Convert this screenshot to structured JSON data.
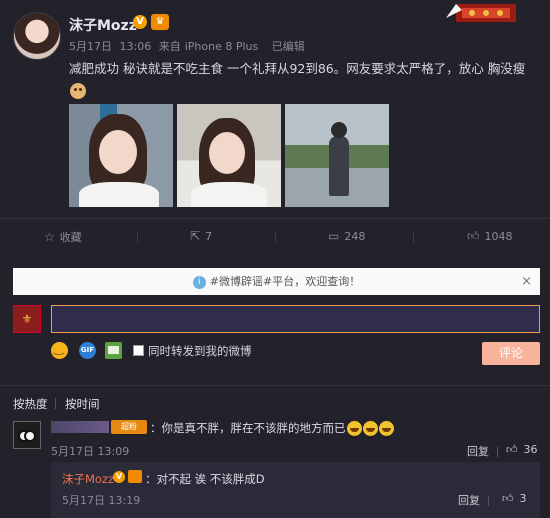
{
  "post": {
    "author": "沫子Mozz",
    "date": "5月17日",
    "time": "13:06",
    "source_prefix": "来自",
    "source": "iPhone 8 Plus",
    "edited": "已编辑",
    "text": "减肥成功 秘诀就是不吃主食 一个礼拜从92到86。网友要求太严格了，放心 胸没瘦",
    "v_badge": "V"
  },
  "actions": {
    "favorite": "收藏",
    "repost_count": "7",
    "comment_count": "248",
    "like_count": "1048"
  },
  "notice": {
    "text": "#微博辟谣#平台，欢迎查询！",
    "close": "×"
  },
  "composer": {
    "repost_label": "同时转发到我的微博",
    "submit": "评论",
    "gif_label": "GIF"
  },
  "sort_tabs": {
    "hot": "按热度",
    "time": "按时间"
  },
  "comment": {
    "badge": "超粉",
    "text": "：你是真不胖，胖在不该胖的地方而已",
    "time": "5月17日 13:09",
    "reply_label": "回复",
    "likes": "36"
  },
  "reply": {
    "author": "沫子Mozz",
    "v_badge": "V",
    "text": "：对不起 诶 不该胖成D",
    "time": "5月17日 13:19",
    "reply_label": "回复",
    "likes": "3"
  },
  "colors": {
    "background": "#23222b",
    "accent_orange": "#f39a4e",
    "reply_name": "#eb7350",
    "submit_button": "#f7b49a"
  },
  "icons": [
    "star-icon",
    "repost-icon",
    "comment-icon",
    "thumbs-up-icon",
    "info-icon",
    "close-icon",
    "emoji-icon",
    "gif-icon",
    "picture-icon"
  ]
}
